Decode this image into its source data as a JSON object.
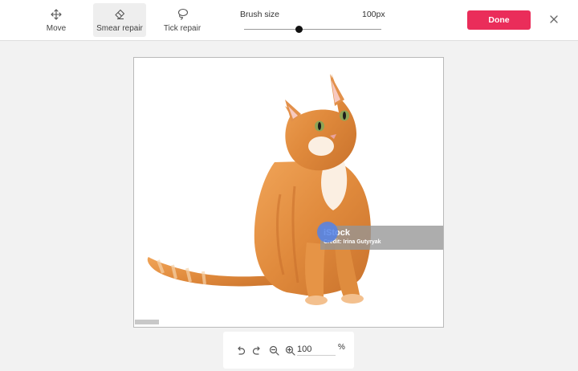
{
  "toolbar": {
    "tools": [
      {
        "label": "Move",
        "icon": "move-icon"
      },
      {
        "label": "Smear repair",
        "icon": "eraser-icon",
        "active": true
      },
      {
        "label": "Tick repair",
        "icon": "lasso-icon"
      }
    ],
    "brush": {
      "label": "Brush size",
      "value_text": "100px",
      "level_fraction": 0.4
    },
    "done_label": "Done",
    "close_icon": "close-icon"
  },
  "canvas": {
    "watermark_logo": "iStock",
    "watermark_credit": "Credit: Irina Gutyryak"
  },
  "zoom": {
    "undo_icon": "undo-icon",
    "redo_icon": "redo-icon",
    "zoom_out_icon": "zoom-out-icon",
    "zoom_in_icon": "zoom-in-icon",
    "value": "100",
    "unit": "%"
  },
  "colors": {
    "accent": "#ea2d5a",
    "brush_cursor": "#5482e8",
    "watermark": "#969696"
  }
}
